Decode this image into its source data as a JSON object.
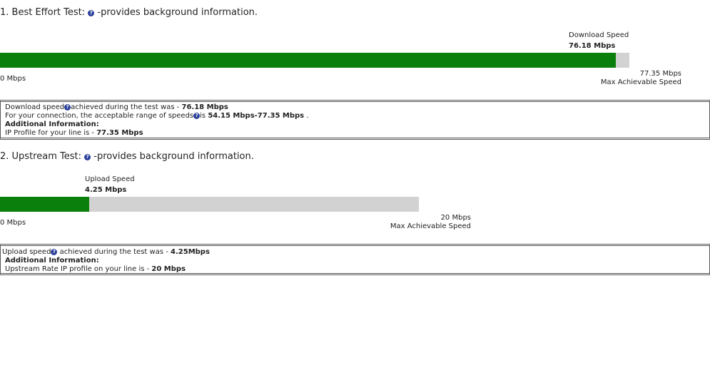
{
  "best_effort": {
    "heading_number": "1. Best Effort Test:",
    "help_symbol": "?",
    "provides_text": "-provides background information.",
    "speed_label": "Download Speed",
    "speed_value": "76.18 Mbps",
    "bar_fill_fraction": 0.979,
    "min_label": "0 Mbps",
    "max_value": "77.35 Mbps",
    "max_label": "Max Achievable Speed",
    "info": {
      "line1_prefix": "Download speed",
      "line1_mid": "achieved during the test was - ",
      "line1_value": "76.18 Mbps",
      "line2_prefix": "For your connection, the acceptable range of speeds",
      "line2_mid": "is ",
      "line2_value": "54.15 Mbps-77.35 Mbps",
      "line2_suffix": " .",
      "additional": "Additional Information:",
      "line4_prefix": "IP Profile for your line is - ",
      "line4_value": "77.35 Mbps"
    }
  },
  "upstream": {
    "heading_number": "2. Upstream Test:",
    "help_symbol": "?",
    "provides_text": "-provides background information.",
    "speed_label": "Upload Speed",
    "speed_value": "4.25 Mbps",
    "bar_fill_fraction": 0.2125,
    "min_label": "0 Mbps",
    "max_value": "20 Mbps",
    "max_label": "Max Achievable Speed",
    "info": {
      "line1_prefix": "Upload speed",
      "line1_mid": " achieved during the test was - ",
      "line1_value": "4.25Mbps",
      "additional": "Additional Information:",
      "line3_prefix": "Upstream Rate IP profile on your line is - ",
      "line3_value": "20 Mbps"
    }
  },
  "colors": {
    "fill": "#0b7f0b",
    "track": "#d2d2d2",
    "help_icon": "#2a3f9a"
  }
}
